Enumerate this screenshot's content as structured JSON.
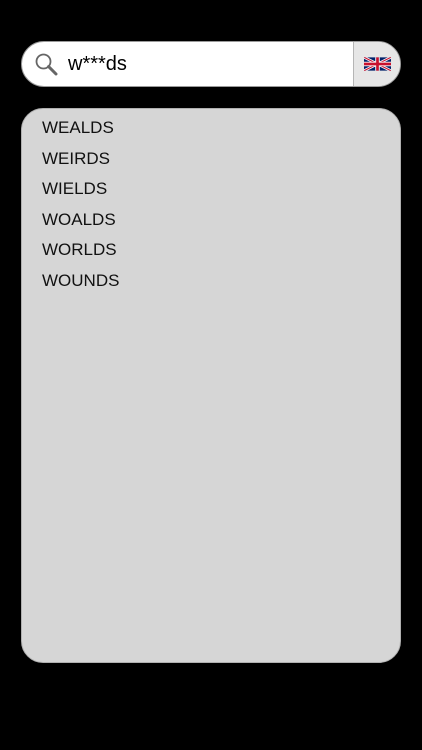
{
  "search": {
    "value": "w***ds",
    "icon": "search-icon"
  },
  "language_button": {
    "icon": "uk-flag-icon"
  },
  "results": [
    "WEALDS",
    "WEIRDS",
    "WIELDS",
    "WOALDS",
    "WORLDS",
    "WOUNDS"
  ],
  "colors": {
    "background": "#000000",
    "panel": "#d6d6d6",
    "search_field": "#ffffff",
    "flag_blue": "#012169",
    "flag_red": "#C8102E"
  }
}
